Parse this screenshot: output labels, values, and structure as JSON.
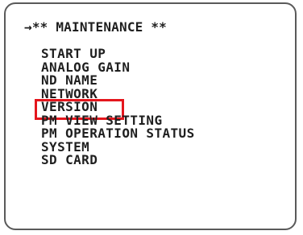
{
  "screen": {
    "title": "→** MAINTENANCE **"
  },
  "menu": {
    "items": [
      {
        "label": "START UP"
      },
      {
        "label": "ANALOG GAIN"
      },
      {
        "label": "ND NAME"
      },
      {
        "label": "NETWORK"
      },
      {
        "label": "VERSION",
        "selected": true
      },
      {
        "label": "PM VIEW SETTING"
      },
      {
        "label": "PM OPERATION STATUS"
      },
      {
        "label": "SYSTEM"
      },
      {
        "label": "SD CARD"
      }
    ]
  },
  "colors": {
    "text": "#1f1f1f",
    "frame": "#5a5a5a",
    "highlight": "#e4161d"
  }
}
